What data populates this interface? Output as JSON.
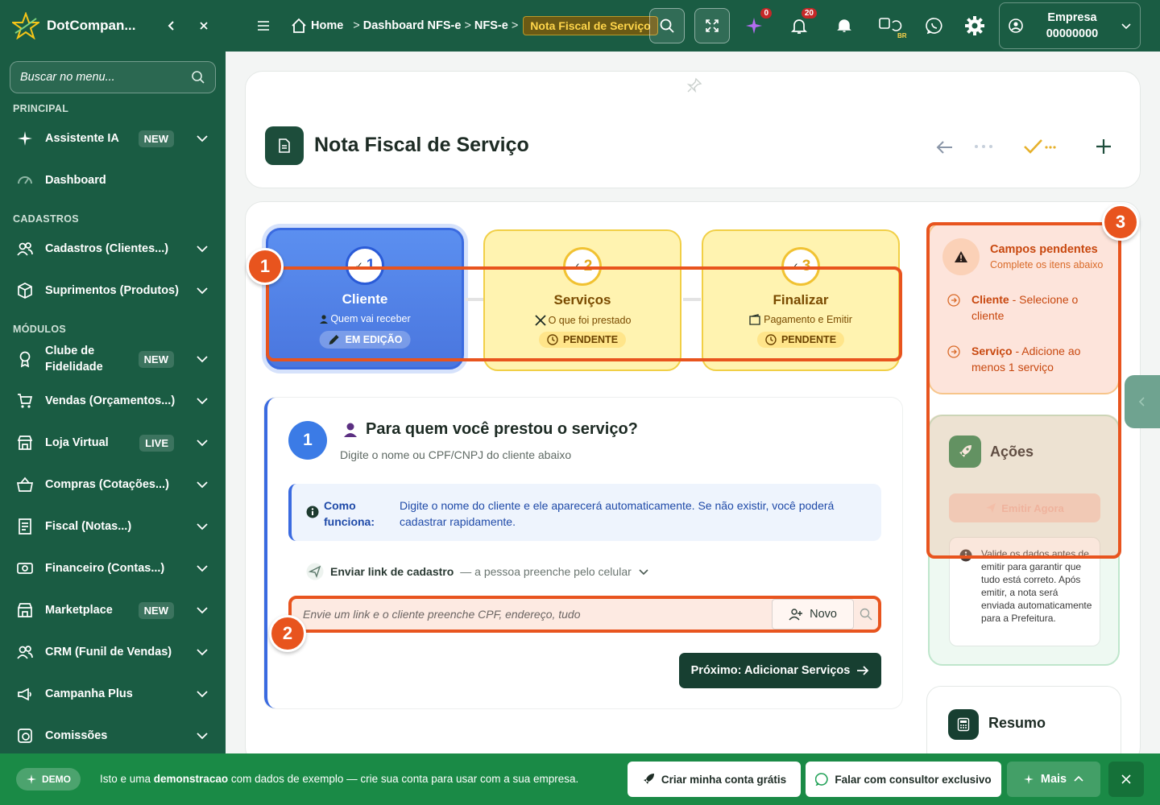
{
  "app": {
    "name": "DotCompan...",
    "collapse_icon": "chevron-left-icon",
    "close_icon": "close-icon"
  },
  "sidebar": {
    "search_placeholder": "Buscar no menu...",
    "sections": {
      "principal": "PRINCIPAL",
      "cadastros": "CADASTROS",
      "modulos": "MÓDULOS"
    },
    "items": [
      {
        "label": "Assistente IA",
        "badge": "NEW",
        "icon": "sparkles-icon"
      },
      {
        "label": "Dashboard",
        "badge": "",
        "icon": "gauge-icon"
      },
      {
        "label": "Cadastros (Clientes...)",
        "badge": "",
        "icon": "users-icon"
      },
      {
        "label": "Suprimentos (Produtos)",
        "badge": "",
        "icon": "box-icon"
      },
      {
        "label": "Clube de Fidelidade",
        "badge": "NEW",
        "icon": "award-icon"
      },
      {
        "label": "Vendas (Orçamentos...)",
        "badge": "",
        "icon": "cart-icon"
      },
      {
        "label": "Loja Virtual",
        "badge": "LIVE",
        "icon": "store-icon"
      },
      {
        "label": "Compras (Cotações...)",
        "badge": "",
        "icon": "basket-icon"
      },
      {
        "label": "Fiscal (Notas...)",
        "badge": "",
        "icon": "receipt-icon"
      },
      {
        "label": "Financeiro (Contas...)",
        "badge": "",
        "icon": "money-icon"
      },
      {
        "label": "Marketplace",
        "badge": "NEW",
        "icon": "marketplace-icon"
      },
      {
        "label": "CRM (Funil de Vendas)",
        "badge": "",
        "icon": "users-icon"
      },
      {
        "label": "Campanha Plus",
        "badge": "",
        "icon": "megaphone-icon"
      },
      {
        "label": "Comissões",
        "badge": "",
        "icon": "coins-icon"
      }
    ]
  },
  "topbar": {
    "breadcrumb": [
      "Home",
      "Dashboard NFS-e",
      "NFS-e"
    ],
    "breadcrumb_active": "Nota Fiscal de Serviço",
    "sparkle_badge": "0",
    "notifications_badge": "20",
    "lang_label": "BR",
    "company_label": "Empresa",
    "company_number": "00000000"
  },
  "header": {
    "title": "Nota Fiscal de Serviço"
  },
  "steps": [
    {
      "number": "1",
      "title": "Cliente",
      "subtitle": "Quem vai receber",
      "status": "EM EDIÇÃO"
    },
    {
      "number": "2",
      "title": "Serviços",
      "subtitle": "O que foi prestado",
      "status": "PENDENTE"
    },
    {
      "number": "3",
      "title": "Finalizar",
      "subtitle": "Pagamento e Emitir",
      "status": "PENDENTE"
    }
  ],
  "annotations": [
    "1",
    "2",
    "3"
  ],
  "form": {
    "step_number": "1",
    "question": "Para quem você prestou o serviço?",
    "subtitle": "Digite o nome ou CPF/CNPJ do cliente abaixo",
    "info_label": "Como funciona:",
    "info_text": "Digite o nome do cliente e ele aparecerá automaticamente. Se não existir, você poderá cadastrar rapidamente.",
    "send_link_label": "Enviar link de cadastro",
    "send_link_hint": "— a pessoa preenche pelo celular",
    "client_placeholder": "Envie um link e o cliente preenche CPF, endereço, tudo",
    "new_button": "Novo",
    "next_button": "Próximo: Adicionar Serviços"
  },
  "pending": {
    "title": "Campos pendentes",
    "subtitle": "Complete os itens abaixo",
    "items": [
      {
        "field": "Cliente",
        "text": " - Selecione o cliente"
      },
      {
        "field": "Serviço",
        "text": " - Adicione ao menos 1 serviço"
      }
    ]
  },
  "actions": {
    "title": "Ações",
    "emit_button": "Emitir Agora",
    "validate_text": "Valide os dados antes de emitir para garantir que tudo está correto. Após emitir, a nota será enviada automaticamente para a Prefeitura."
  },
  "summary": {
    "title": "Resumo"
  },
  "bottombar": {
    "demo_label": "DEMO",
    "text_pre": "Isto e uma ",
    "text_bold": "demonstracao",
    "text_post": " com dados de exemplo — crie sua conta para usar com a sua empresa.",
    "create_account": "Criar minha conta grátis",
    "talk_consultant": "Falar com consultor exclusivo",
    "more": "Mais"
  },
  "colors": {
    "sidebar": "#1a5c43",
    "accent_blue": "#3a6ae0",
    "highlight": "#e8541e",
    "pending": "#c8480f",
    "bottombar": "#1a8a46"
  }
}
